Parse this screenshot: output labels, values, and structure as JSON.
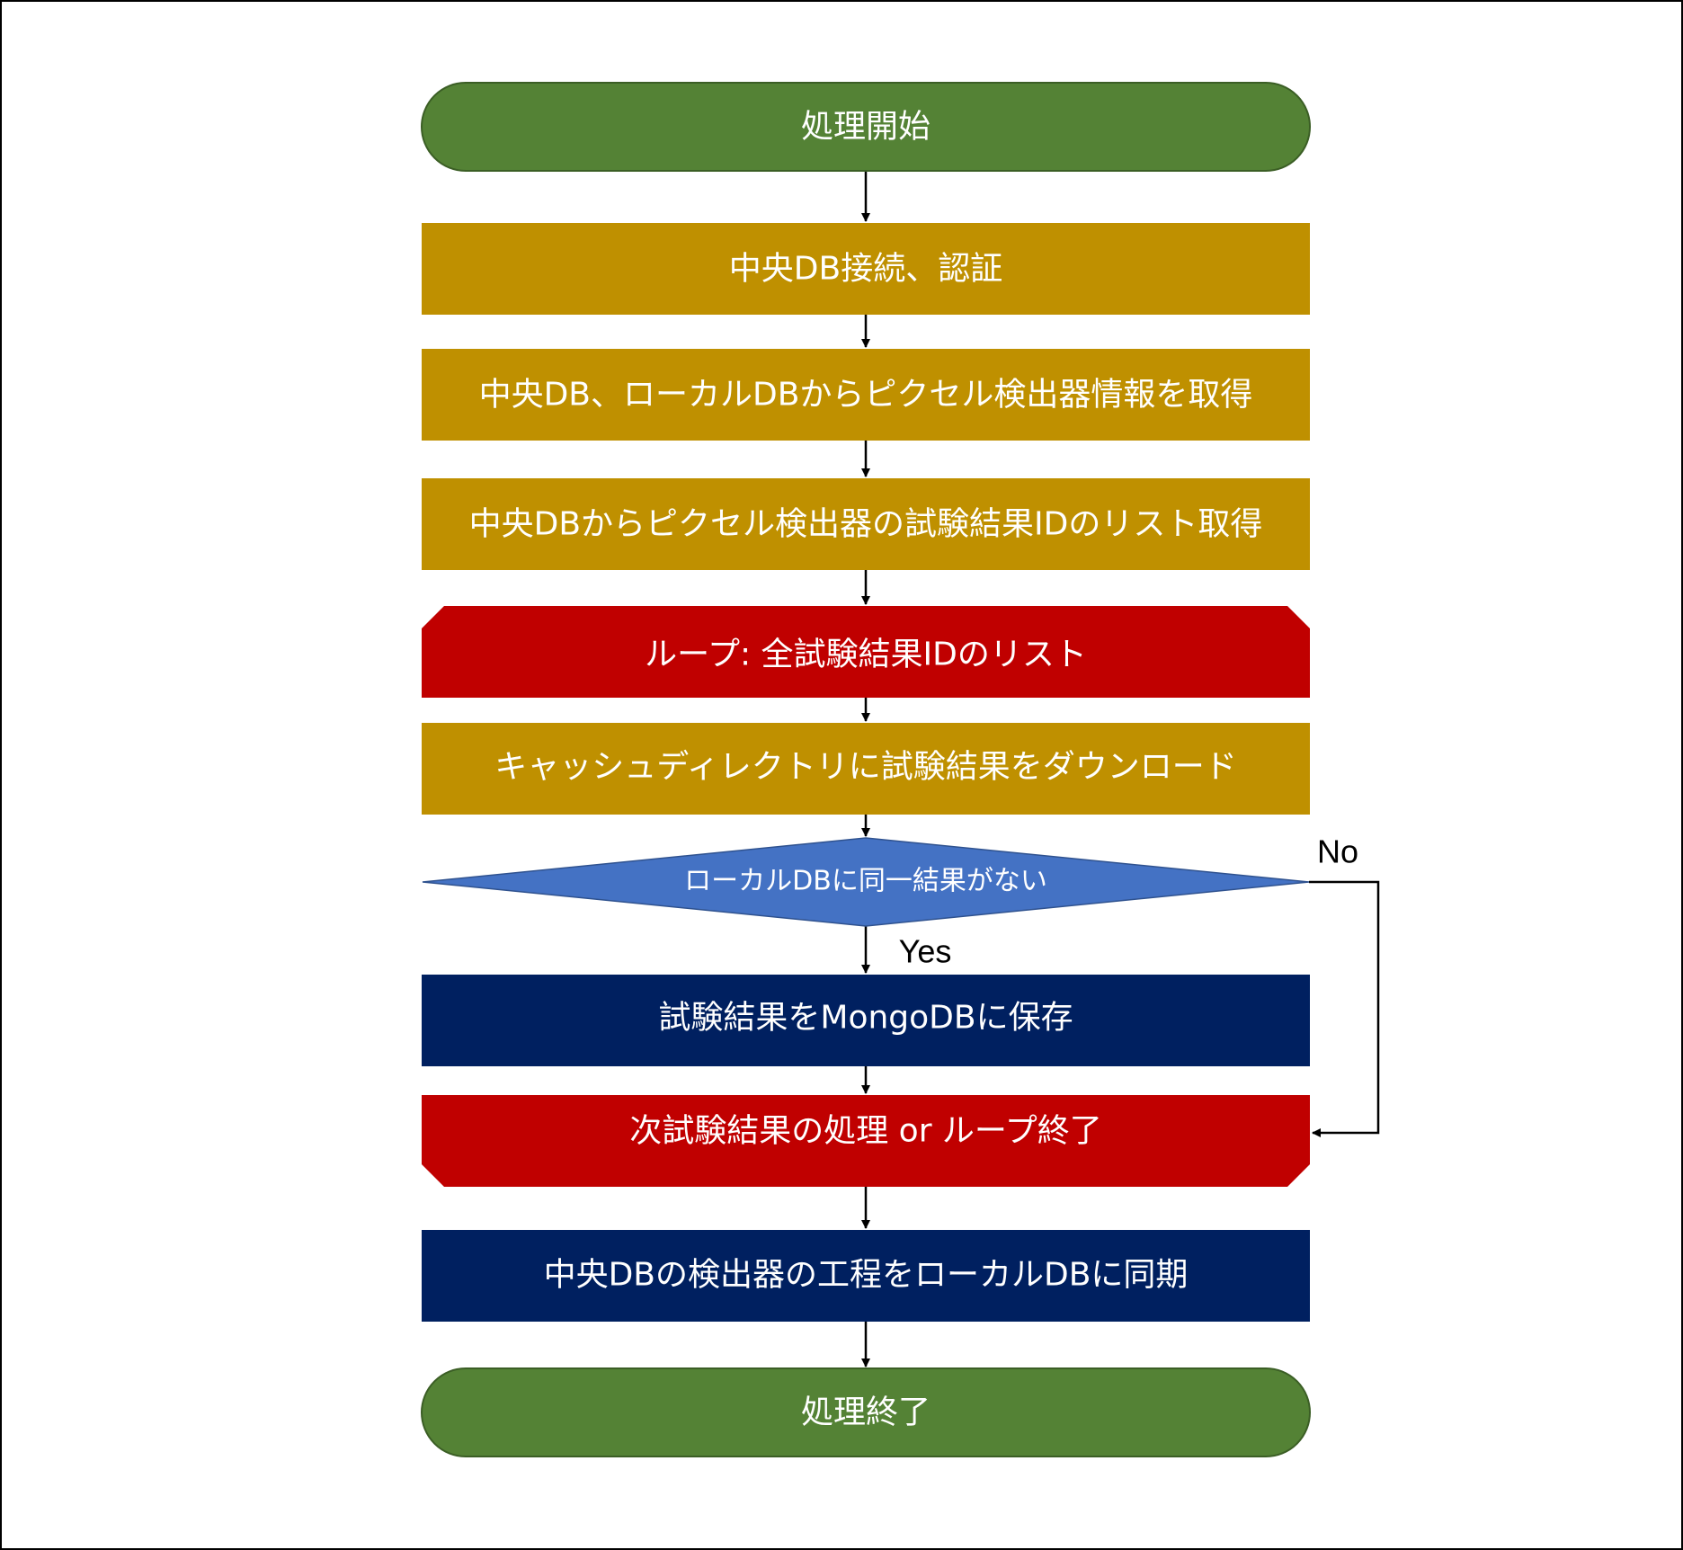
{
  "colors": {
    "terminal": "#548235",
    "process": "#BF9000",
    "loop": "#C00000",
    "decision": "#4472C4",
    "storage": "#002060",
    "connector": "#000000",
    "text": "#FFFFFF"
  },
  "nodes": {
    "start": {
      "label": "処理開始"
    },
    "connect": {
      "label": "中央DB接続、認証"
    },
    "fetch_info": {
      "label": "中央DB、ローカルDBからピクセル検出器情報を取得"
    },
    "fetch_ids": {
      "label": "中央DBからピクセル検出器の試験結果IDのリスト取得"
    },
    "loop_start": {
      "label": "ループ: 全試験結果IDのリスト"
    },
    "download": {
      "label": "キャッシュディレクトリに試験結果をダウンロード"
    },
    "decision": {
      "label": "ローカルDBに同一結果がない"
    },
    "save": {
      "label": "試験結果をMongoDBに保存"
    },
    "loop_end": {
      "label": "次試験結果の処理 or ループ終了"
    },
    "sync": {
      "label": "中央DBの検出器の工程をローカルDBに同期"
    },
    "end": {
      "label": "処理終了"
    }
  },
  "branches": {
    "no": "No",
    "yes": "Yes"
  }
}
